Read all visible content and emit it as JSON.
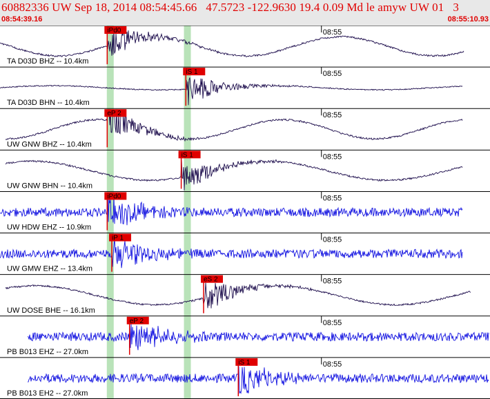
{
  "header": {
    "title": "60882336 UW Sep 18, 2014 08:54:45.66   47.5723 -122.9630 19.4 0.09 Md le amyw UW 01   3",
    "time_start": "08:54:39.16",
    "time_end": "08:55:10.93"
  },
  "minute_label": "08:55",
  "colors": {
    "header_text": "#e00000",
    "pick": "#e00000",
    "pick_band": "#b9e3b9",
    "trace_velocity": "#1a0a4a",
    "trace_acceleration": "#1010e0",
    "frame": "#000000"
  },
  "pick_times_s": {
    "P": 7.15,
    "S": 12.15
  },
  "traces": [
    {
      "label": "TA D03D BHZ -- 10.4km",
      "pick": "iPd0",
      "pick_time_s": 6.95,
      "color": "trace_velocity",
      "kind": "lowfreq"
    },
    {
      "label": "TA D03D BHN -- 10.4km",
      "pick": "iS 1",
      "pick_time_s": 12.05,
      "color": "trace_velocity",
      "kind": "flat"
    },
    {
      "label": "UW GNW BHZ -- 10.4km",
      "pick": "eP 2",
      "pick_time_s": 6.95,
      "color": "trace_velocity",
      "kind": "lowfreq"
    },
    {
      "label": "UW GNW BHN -- 10.4km",
      "pick": "iS 1",
      "pick_time_s": 11.75,
      "color": "trace_velocity",
      "kind": "lowfreq"
    },
    {
      "label": "UW HDW EHZ -- 10.9km",
      "pick": "iPd0",
      "pick_time_s": 6.95,
      "color": "trace_acceleration",
      "kind": "noise"
    },
    {
      "label": "UW GMW EHZ -- 13.4km",
      "pick": "iP 1",
      "pick_time_s": 7.25,
      "color": "trace_acceleration",
      "kind": "noise"
    },
    {
      "label": "UW DOSE BHE -- 16.1km",
      "pick": "eS 2",
      "pick_time_s": 13.2,
      "color": "trace_velocity",
      "kind": "lowfreq"
    },
    {
      "label": "PB B013 EHZ -- 27.0km",
      "pick": "eP 2",
      "pick_time_s": 8.4,
      "color": "trace_acceleration",
      "kind": "noise"
    },
    {
      "label": "PB B013 EH2 -- 27.0km",
      "pick": "iS 1",
      "pick_time_s": 15.45,
      "color": "trace_acceleration",
      "kind": "noise"
    }
  ]
}
